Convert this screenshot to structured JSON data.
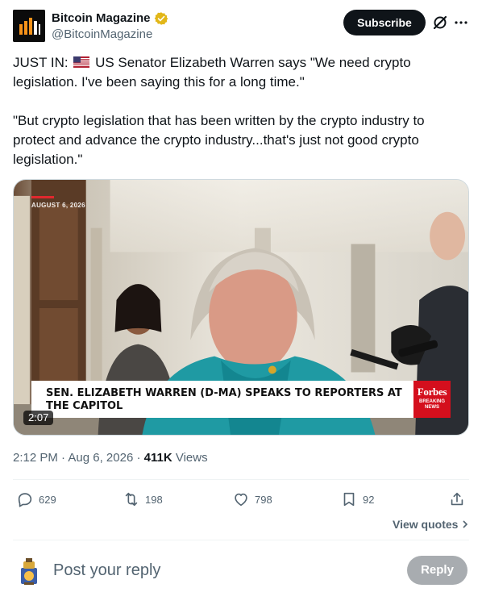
{
  "author": {
    "display_name": "Bitcoin Magazine",
    "handle": "@BitcoinMagazine",
    "verified_badge_icon": "verified-gold-icon"
  },
  "header": {
    "subscribe_label": "Subscribe",
    "grok_icon": "grok-icon",
    "more_icon": "more-icon"
  },
  "tweet": {
    "prefix": "JUST IN:",
    "flag_icon": "us-flag-icon",
    "text_line1_rest": " US Senator Elizabeth Warren says \"We need crypto legislation. I've been saying this for a long time.\"",
    "text_quote": "\"But crypto legislation that has been written by the crypto industry to protect and advance the crypto industry...that's just not good crypto legislation.\""
  },
  "media": {
    "date_overlay": "AUGUST 6, 2026",
    "lower_third": "SEN. ELIZABETH WARREN (D-MA) SPEAKS TO REPORTERS AT THE CAPITOL",
    "brand": "Forbes",
    "brand_sub": "BREAKING NEWS",
    "duration": "2:07"
  },
  "meta": {
    "time": "2:12 PM",
    "date": "Aug 6, 2026",
    "views_count": "411K",
    "views_label": "Views"
  },
  "actions": {
    "replies": "629",
    "reposts": "198",
    "likes": "798",
    "bookmarks": "92"
  },
  "view_quotes_label": "View quotes",
  "reply": {
    "placeholder": "Post your reply",
    "button_label": "Reply"
  },
  "colors": {
    "accent_black": "#0f1419",
    "secondary_text": "#536471",
    "verified_gold": "#e2b719",
    "forbes_red": "#d40f1d",
    "reply_button_disabled": "#8c9196"
  }
}
